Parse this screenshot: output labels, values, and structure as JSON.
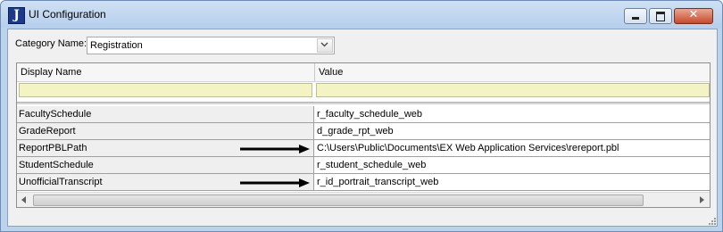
{
  "window": {
    "title": "UI Configuration",
    "icon_letter": "J",
    "icon": "app-logo-icon",
    "controls": [
      "minimize-icon",
      "maximize-icon",
      "close-icon"
    ]
  },
  "category": {
    "label": "Category Name:",
    "selected": "Registration"
  },
  "grid": {
    "columns": [
      "Display Name",
      "Value"
    ],
    "rows": [
      {
        "name": "FacultySchedule",
        "value": "r_faculty_schedule_web"
      },
      {
        "name": "GradeReport",
        "value": "d_grade_rpt_web"
      },
      {
        "name": "ReportPBLPath",
        "value": "C:\\Users\\Public\\Documents\\EX Web Application Services\\rereport.pbl"
      },
      {
        "name": "StudentSchedule",
        "value": "r_student_schedule_web"
      },
      {
        "name": "UnofficialTranscript",
        "value": "r_id_portrait_transcript_web"
      }
    ]
  },
  "colors": {
    "title_bar": "#bcd3ee",
    "filter_row": "#f4f3c3",
    "close_button": "#c74a2d"
  }
}
